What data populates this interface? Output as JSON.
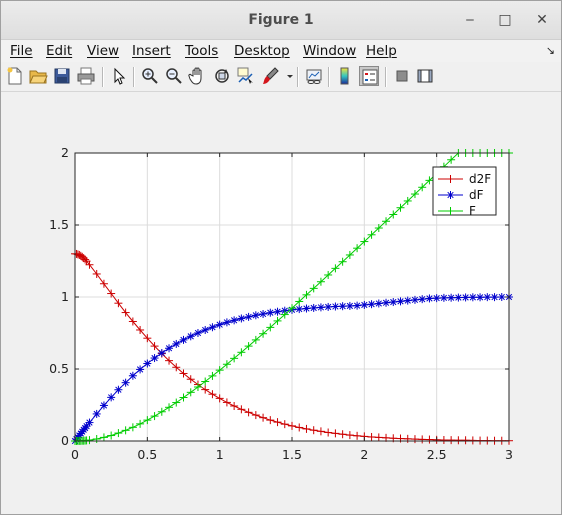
{
  "window": {
    "title": "Figure 1"
  },
  "window_controls": {
    "minimize": "‒",
    "maximize": "□",
    "close": "✕"
  },
  "menu": {
    "items": [
      "File",
      "Edit",
      "View",
      "Insert",
      "Tools",
      "Desktop",
      "Window",
      "Help"
    ],
    "dock_arrow": "↘"
  },
  "toolbar": {
    "buttons": [
      "new-figure",
      "open-file",
      "save",
      "print",
      "pointer",
      "zoom-in",
      "zoom-out",
      "pan",
      "rotate-3d",
      "data-cursor",
      "brush",
      "link-plot",
      "colorbar",
      "legend",
      "hide-plot-tools",
      "show-plot-tools"
    ],
    "pressed": [
      "legend"
    ]
  },
  "chart_data": {
    "type": "line",
    "xlim": [
      0,
      3
    ],
    "ylim": [
      0,
      2
    ],
    "xticks": [
      0,
      0.5,
      1,
      1.5,
      2,
      2.5,
      3
    ],
    "xtick_labels": [
      "0",
      "0.5",
      "1",
      "1.5",
      "2",
      "2.5",
      "3"
    ],
    "yticks": [
      0,
      0.5,
      1,
      1.5,
      2
    ],
    "ytick_labels": [
      "0",
      "0.5",
      "1",
      "1.5",
      "2"
    ],
    "grid": true,
    "legend_position": "top-right",
    "x": [
      0,
      0.01,
      0.02,
      0.03,
      0.04,
      0.05,
      0.06,
      0.07,
      0.08,
      0.1,
      0.15,
      0.2,
      0.25,
      0.3,
      0.35,
      0.4,
      0.45,
      0.5,
      0.55,
      0.6,
      0.65,
      0.7,
      0.75,
      0.8,
      0.85,
      0.9,
      0.95,
      1.0,
      1.05,
      1.1,
      1.15,
      1.2,
      1.25,
      1.3,
      1.35,
      1.4,
      1.45,
      1.5,
      1.55,
      1.6,
      1.65,
      1.7,
      1.75,
      1.8,
      1.85,
      1.9,
      1.95,
      2.0,
      2.05,
      2.1,
      2.15,
      2.2,
      2.25,
      2.3,
      2.35,
      2.4,
      2.45,
      2.5,
      2.55,
      2.6,
      2.65,
      2.7,
      2.75,
      2.8,
      2.85,
      2.9,
      2.95,
      3.0
    ],
    "series": [
      {
        "name": "d2F",
        "color": "#cc0000",
        "marker": "plus",
        "values": [
          1.3,
          1.299,
          1.296,
          1.292,
          1.286,
          1.279,
          1.27,
          1.26,
          1.249,
          1.224,
          1.16,
          1.092,
          1.024,
          0.957,
          0.892,
          0.83,
          0.771,
          0.714,
          0.659,
          0.607,
          0.558,
          0.512,
          0.469,
          0.429,
          0.392,
          0.357,
          0.325,
          0.296,
          0.268,
          0.243,
          0.22,
          0.199,
          0.18,
          0.162,
          0.145,
          0.131,
          0.117,
          0.105,
          0.094,
          0.084,
          0.075,
          0.067,
          0.059,
          0.053,
          0.047,
          0.041,
          0.036,
          0.032,
          0.028,
          0.025,
          0.022,
          0.019,
          0.017,
          0.015,
          0.013,
          0.011,
          0.01,
          0.008,
          0.007,
          0.006,
          0.005,
          0.005,
          0.004,
          0.003,
          0.003,
          0.002,
          0.002,
          0.002
        ]
      },
      {
        "name": "dF",
        "color": "#0000cc",
        "marker": "asterisk",
        "values": [
          0,
          0.013,
          0.026,
          0.039,
          0.052,
          0.065,
          0.078,
          0.09,
          0.103,
          0.128,
          0.188,
          0.247,
          0.303,
          0.356,
          0.405,
          0.453,
          0.497,
          0.538,
          0.576,
          0.611,
          0.644,
          0.674,
          0.702,
          0.727,
          0.75,
          0.771,
          0.79,
          0.808,
          0.824,
          0.838,
          0.851,
          0.862,
          0.873,
          0.882,
          0.891,
          0.898,
          0.905,
          0.911,
          0.916,
          0.92,
          0.924,
          0.928,
          0.931,
          0.934,
          0.936,
          0.938,
          0.94,
          0.945,
          0.95,
          0.955,
          0.96,
          0.965,
          0.97,
          0.975,
          0.98,
          0.985,
          0.99,
          0.992,
          0.994,
          0.995,
          0.996,
          0.997,
          0.998,
          0.998,
          0.999,
          0.999,
          1.0,
          1.0
        ]
      },
      {
        "name": "F",
        "color": "#00cc00",
        "marker": "plus",
        "values": [
          0,
          0,
          0,
          0.001,
          0.001,
          0.002,
          0.002,
          0.003,
          0.004,
          0.006,
          0.014,
          0.025,
          0.038,
          0.055,
          0.074,
          0.095,
          0.119,
          0.145,
          0.173,
          0.203,
          0.234,
          0.267,
          0.302,
          0.338,
          0.375,
          0.413,
          0.452,
          0.492,
          0.533,
          0.574,
          0.616,
          0.659,
          0.702,
          0.745,
          0.789,
          0.834,
          0.878,
          0.923,
          0.969,
          1.015,
          1.06,
          1.106,
          1.153,
          1.199,
          1.245,
          1.292,
          1.339,
          1.385,
          1.432,
          1.479,
          1.526,
          1.573,
          1.62,
          1.667,
          1.715,
          1.762,
          1.81,
          1.857,
          1.905,
          1.953,
          2.0,
          2.0,
          2.0,
          2.0,
          2.0,
          2.0,
          2.0,
          2.0
        ]
      }
    ]
  }
}
